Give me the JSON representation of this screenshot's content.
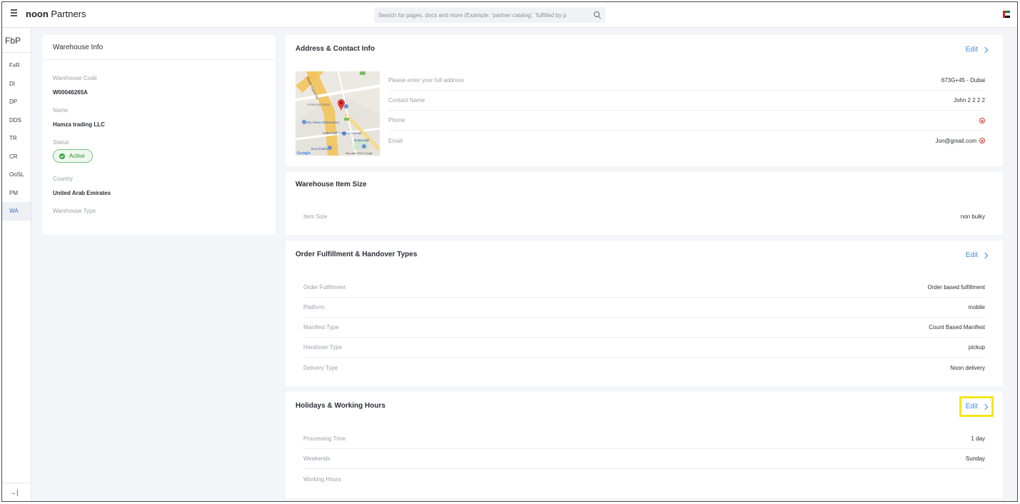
{
  "topbar": {
    "brand_bold": "noon",
    "brand_rest": " Partners",
    "search_placeholder": "Search for pages, docs and more (Example: 'partner catalog', 'fulfilled by p",
    "flag_colors": [
      "#d81f26",
      "#00843d",
      "#ffffff",
      "#000000"
    ]
  },
  "rail": {
    "title": "FbP",
    "items": [
      "FxR",
      "DI",
      "DP",
      "DDS",
      "TR",
      "CR",
      "OoSL",
      "PM",
      "WA"
    ],
    "active": "WA",
    "collapse_icon": "→|"
  },
  "warehouse_info": {
    "title": "Warehouse Info",
    "code_label": "Warehouse Code",
    "code_value": "W00046265A",
    "name_label": "Name",
    "name_value": "Hamza trading LLC",
    "status_label": "Status",
    "status_value": "Active",
    "country_label": "Country",
    "country_value": "United Arab Emirates",
    "type_label": "Warehouse Type"
  },
  "address": {
    "title": "Address & Contact Info",
    "edit_label": "Edit",
    "map_labels": {
      "road": "Sheikh Zayed Rd",
      "place1": "Al Murooj Dubai",
      "place2": "Sky Views Observatory",
      "place3": "Dubai Mall Fashion Avenue",
      "place4": "Dubai Mall",
      "place5": "Burj Khalifa",
      "google": "Google",
      "map_data": "Map data ©2024 Google"
    },
    "rows": [
      {
        "label": "Please enter your full address",
        "value": "673G+45 - Dubai"
      },
      {
        "label": "Contact Name",
        "value": "John 2 2 2 2"
      },
      {
        "label": "Phone",
        "value": ""
      },
      {
        "label": "Email",
        "value": "Jon@gmail.com"
      }
    ]
  },
  "item_size": {
    "title": "Warehouse Item Size",
    "label": "Item Size",
    "value": "non bulky"
  },
  "fulfillment": {
    "title": "Order Fulfillment & Handover Types",
    "edit_label": "Edit",
    "rows": [
      {
        "label": "Order Fulfillment",
        "value": "Order based fulfillment"
      },
      {
        "label": "Platform",
        "value": "mobile"
      },
      {
        "label": "Manifest Type",
        "value": "Count Based Manifest"
      },
      {
        "label": "Handover Type",
        "value": "pickup"
      },
      {
        "label": "Delivery Type",
        "value": "Noon delivery"
      }
    ]
  },
  "holidays": {
    "title": "Holidays & Working Hours",
    "edit_label": "Edit",
    "rows": [
      {
        "label": "Processing Time",
        "value": "1 day"
      },
      {
        "label": "Weekends",
        "value": "Sunday"
      },
      {
        "label": "Working Hours",
        "value": ""
      }
    ]
  }
}
